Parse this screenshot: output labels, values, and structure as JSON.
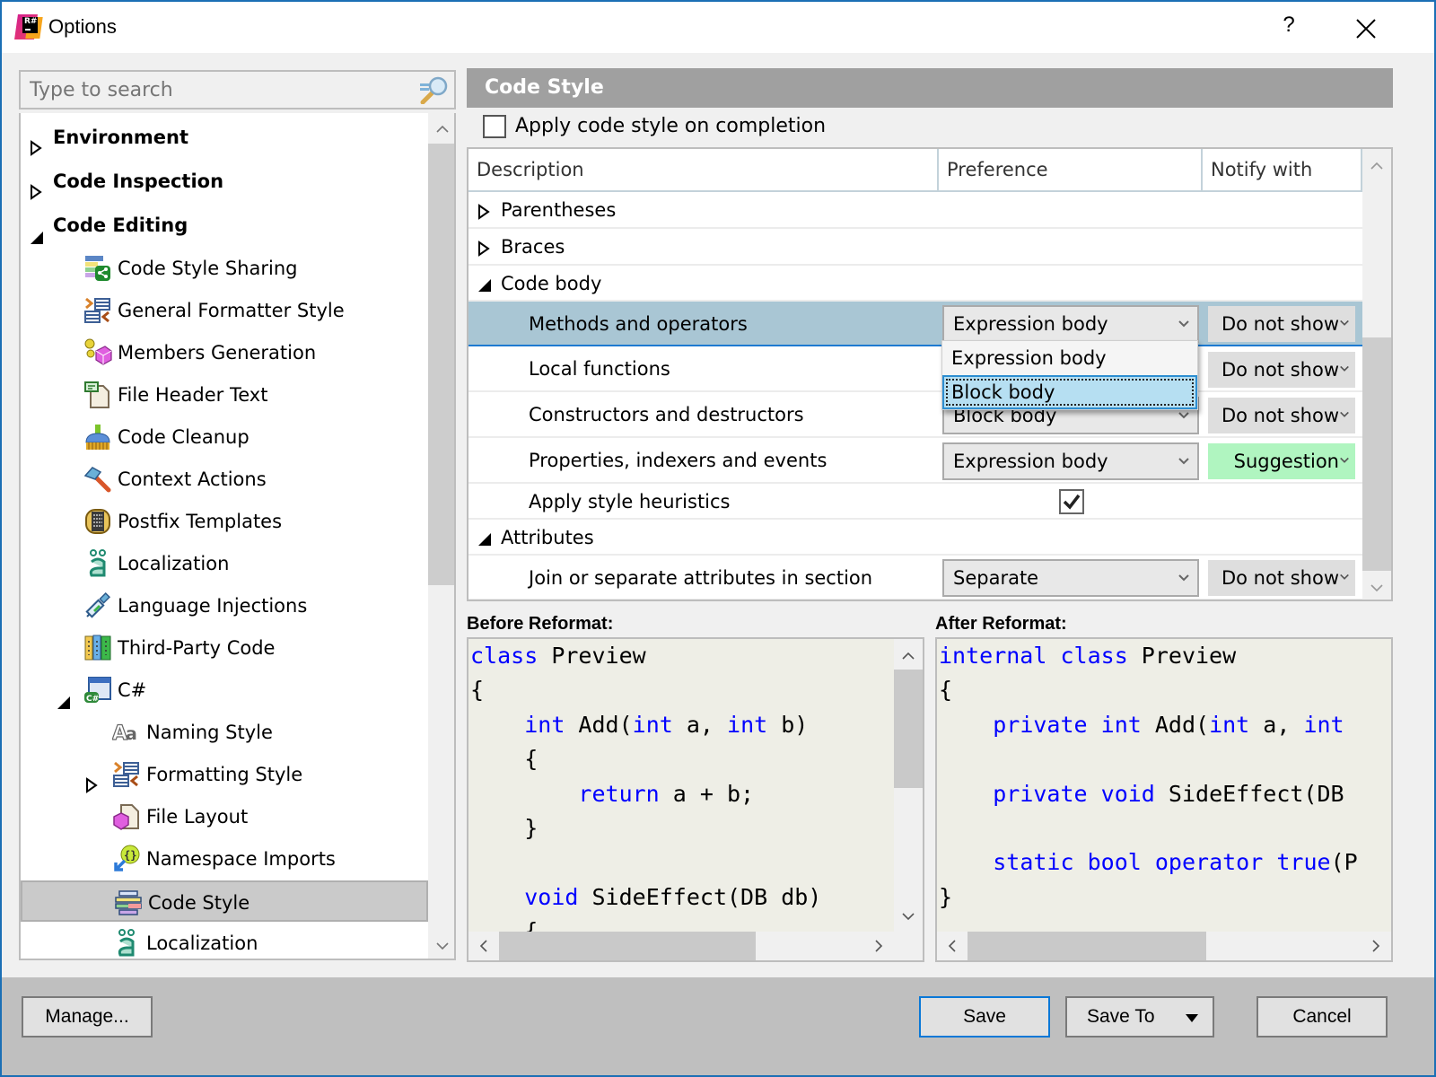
{
  "window": {
    "title": "Options",
    "help_label": "?",
    "close_label": "close"
  },
  "search": {
    "placeholder": "Type to search",
    "value": ""
  },
  "tree": {
    "items": [
      {
        "label": "Environment",
        "level": 0,
        "expander": "collapsed",
        "icon": "none",
        "bold": true
      },
      {
        "label": "Code Inspection",
        "level": 0,
        "expander": "collapsed",
        "icon": "none",
        "bold": true
      },
      {
        "label": "Code Editing",
        "level": 0,
        "expander": "expanded",
        "icon": "none",
        "bold": true
      },
      {
        "label": "Code Style Sharing",
        "level": 1,
        "expander": "none",
        "icon": "code-style-sharing-icon"
      },
      {
        "label": "General Formatter Style",
        "level": 1,
        "expander": "none",
        "icon": "formatter-style-icon"
      },
      {
        "label": "Members Generation",
        "level": 1,
        "expander": "none",
        "icon": "members-generation-icon"
      },
      {
        "label": "File Header Text",
        "level": 1,
        "expander": "none",
        "icon": "file-header-icon"
      },
      {
        "label": "Code Cleanup",
        "level": 1,
        "expander": "none",
        "icon": "broom-icon"
      },
      {
        "label": "Context Actions",
        "level": 1,
        "expander": "none",
        "icon": "hammer-icon"
      },
      {
        "label": "Postfix Templates",
        "level": 1,
        "expander": "none",
        "icon": "postfix-templates-icon"
      },
      {
        "label": "Localization",
        "level": 1,
        "expander": "none",
        "icon": "localization-icon"
      },
      {
        "label": "Language Injections",
        "level": 1,
        "expander": "none",
        "icon": "syringe-icon"
      },
      {
        "label": "Third-Party Code",
        "level": 1,
        "expander": "none",
        "icon": "books-icon"
      },
      {
        "label": "C#",
        "level": 1,
        "expander": "expanded",
        "icon": "csharp-icon"
      },
      {
        "label": "Naming Style",
        "level": 2,
        "expander": "none",
        "icon": "naming-style-icon"
      },
      {
        "label": "Formatting Style",
        "level": 2,
        "expander": "collapsed",
        "icon": "formatter-style-icon"
      },
      {
        "label": "File Layout",
        "level": 2,
        "expander": "none",
        "icon": "file-layout-icon"
      },
      {
        "label": "Namespace Imports",
        "level": 2,
        "expander": "none",
        "icon": "namespace-imports-icon"
      },
      {
        "label": "Code Style",
        "level": 2,
        "expander": "none",
        "icon": "code-style-icon",
        "selected": true
      },
      {
        "label": "Localization",
        "level": 2,
        "expander": "none",
        "icon": "localization-icon"
      }
    ]
  },
  "main": {
    "section_title": "Code Style",
    "apply_on_completion": {
      "label": "Apply code style on completion",
      "checked": false
    },
    "grid": {
      "columns": [
        "Description",
        "Preference",
        "Notify with"
      ],
      "rows": [
        {
          "type": "group",
          "label": "Parentheses",
          "expander": "collapsed"
        },
        {
          "type": "group",
          "label": "Braces",
          "expander": "collapsed"
        },
        {
          "type": "group",
          "label": "Code body",
          "expander": "expanded"
        },
        {
          "type": "setting",
          "label": "Methods and operators",
          "preference": "Expression body",
          "notify": "Do not show",
          "selected": true
        },
        {
          "type": "setting",
          "label": "Local functions",
          "preference": "",
          "notify": "Do not show"
        },
        {
          "type": "setting",
          "label": "Constructors and destructors",
          "preference": "Block body",
          "notify": "Do not show"
        },
        {
          "type": "setting",
          "label": "Properties, indexers and events",
          "preference": "Expression body",
          "notify": "Suggestion"
        },
        {
          "type": "checkbox",
          "label": "Apply style heuristics",
          "checked": true
        },
        {
          "type": "group",
          "label": "Attributes",
          "expander": "expanded"
        },
        {
          "type": "setting",
          "label": "Join or separate attributes in section",
          "preference": "Separate",
          "notify": "Do not show"
        }
      ]
    },
    "dropdown_open": {
      "options": [
        "Expression body",
        "Block body"
      ],
      "highlighted": "Block body"
    },
    "before_label": "Before Reformat:",
    "after_label": "After Reformat:",
    "before_code": [
      [
        {
          "t": "class",
          "k": true
        },
        {
          "t": " Preview"
        }
      ],
      [
        {
          "t": "{"
        }
      ],
      [
        {
          "t": "    "
        },
        {
          "t": "int",
          "k": true
        },
        {
          "t": " Add("
        },
        {
          "t": "int",
          "k": true
        },
        {
          "t": " a, "
        },
        {
          "t": "int",
          "k": true
        },
        {
          "t": " b)"
        }
      ],
      [
        {
          "t": "    {"
        }
      ],
      [
        {
          "t": "        "
        },
        {
          "t": "return",
          "k": true
        },
        {
          "t": " a + b;"
        }
      ],
      [
        {
          "t": "    }"
        }
      ],
      [
        {
          "t": ""
        }
      ],
      [
        {
          "t": "    "
        },
        {
          "t": "void",
          "k": true
        },
        {
          "t": " SideEffect(DB db)"
        }
      ],
      [
        {
          "t": "    {"
        }
      ]
    ],
    "after_code": [
      [
        {
          "t": "internal",
          "k": true
        },
        {
          "t": " "
        },
        {
          "t": "class",
          "k": true
        },
        {
          "t": " Preview"
        }
      ],
      [
        {
          "t": "{"
        }
      ],
      [
        {
          "t": "    "
        },
        {
          "t": "private",
          "k": true
        },
        {
          "t": " "
        },
        {
          "t": "int",
          "k": true
        },
        {
          "t": " Add("
        },
        {
          "t": "int",
          "k": true
        },
        {
          "t": " a, "
        },
        {
          "t": "int",
          "k": true
        }
      ],
      [
        {
          "t": ""
        }
      ],
      [
        {
          "t": "    "
        },
        {
          "t": "private",
          "k": true
        },
        {
          "t": " "
        },
        {
          "t": "void",
          "k": true
        },
        {
          "t": " SideEffect(DB"
        }
      ],
      [
        {
          "t": ""
        }
      ],
      [
        {
          "t": "    "
        },
        {
          "t": "static",
          "k": true
        },
        {
          "t": " "
        },
        {
          "t": "bool",
          "k": true
        },
        {
          "t": " "
        },
        {
          "t": "operator",
          "k": true
        },
        {
          "t": " "
        },
        {
          "t": "true",
          "k": true
        },
        {
          "t": "(P"
        }
      ],
      [
        {
          "t": "}"
        }
      ]
    ]
  },
  "footer": {
    "manage_label": "Manage...",
    "save_label": "Save",
    "save_to_label": "Save To",
    "cancel_label": "Cancel"
  },
  "colors": {
    "accent": "#1b6fb5",
    "selected_row": "#a9c6d4",
    "suggestion": "#b0f5c0",
    "keyword": "#0000ff",
    "header_bar": "#a0a0a0"
  }
}
